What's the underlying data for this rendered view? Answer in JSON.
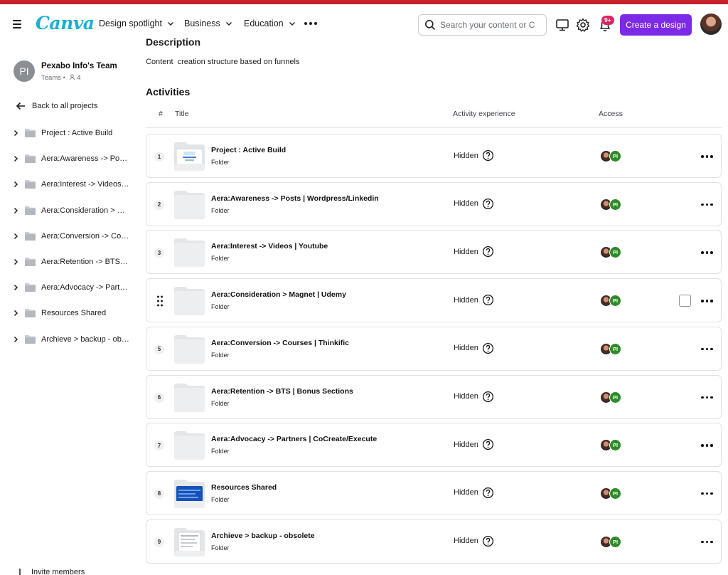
{
  "header": {
    "logo": "Canva",
    "nav": [
      {
        "label": "Design spotlight"
      },
      {
        "label": "Business"
      },
      {
        "label": "Education"
      }
    ],
    "search_placeholder": "Search your content or C",
    "notification_badge": "9+",
    "create_label": "Create a design"
  },
  "sidebar": {
    "team_initials": "PI",
    "team_name": "Pexabo Info's Team",
    "team_meta": "Teams •",
    "member_count": "4",
    "back_label": "Back to all projects",
    "folders": [
      {
        "label": "Project : Active Build"
      },
      {
        "label": "Aera:Awareness -> Posts | Wordpress/Linkedin"
      },
      {
        "label": "Aera:Interest -> Videos | Youtube"
      },
      {
        "label": "Aera:Consideration > Magnet | Udemy"
      },
      {
        "label": "Aera:Conversion -> Courses | Thinkific"
      },
      {
        "label": "Aera:Retention -> BTS | Bonus Sections"
      },
      {
        "label": "Aera:Advocacy -> Partners | CoCreate/Execute"
      },
      {
        "label": "Resources Shared"
      },
      {
        "label": "Archieve > backup - obsolete"
      }
    ],
    "invite_label": "Invite members"
  },
  "main": {
    "description_heading": "Description",
    "description_text": "Content  creation structure based on funnels",
    "activities_heading": "Activities",
    "columns": {
      "num": "#",
      "title": "Title",
      "experience": "Activity experience",
      "access": "Access"
    },
    "rows": [
      {
        "num": "1",
        "title": "Project : Active Build",
        "type": "Folder",
        "visibility": "Hidden",
        "thumb": "doc-preview",
        "access_initials": "PI"
      },
      {
        "num": "2",
        "title": "Aera:Awareness -> Posts | Wordpress/Linkedin",
        "type": "Folder",
        "visibility": "Hidden",
        "thumb": "empty",
        "access_initials": "PI"
      },
      {
        "num": "3",
        "title": "Aera:Interest -> Videos | Youtube",
        "type": "Folder",
        "visibility": "Hidden",
        "thumb": "empty",
        "access_initials": "PI"
      },
      {
        "num": "4",
        "title": "Aera:Consideration > Magnet | Udemy",
        "type": "Folder",
        "visibility": "Hidden",
        "thumb": "empty",
        "access_initials": "PI",
        "hovered": true
      },
      {
        "num": "5",
        "title": "Aera:Conversion -> Courses | Thinkific",
        "type": "Folder",
        "visibility": "Hidden",
        "thumb": "empty",
        "access_initials": "PI"
      },
      {
        "num": "6",
        "title": "Aera:Retention -> BTS | Bonus Sections",
        "type": "Folder",
        "visibility": "Hidden",
        "thumb": "empty",
        "access_initials": "PI"
      },
      {
        "num": "7",
        "title": "Aera:Advocacy -> Partners | CoCreate/Execute",
        "type": "Folder",
        "visibility": "Hidden",
        "thumb": "empty",
        "access_initials": "PI"
      },
      {
        "num": "8",
        "title": "Resources Shared",
        "type": "Folder",
        "visibility": "Hidden",
        "thumb": "blue-preview",
        "access_initials": "PI"
      },
      {
        "num": "9",
        "title": "Archieve > backup - obsolete",
        "type": "Folder",
        "visibility": "Hidden",
        "thumb": "list-preview",
        "access_initials": "PI"
      }
    ]
  },
  "colors": {
    "brand_purple": "#7d2ae8",
    "logo_teal": "#19b0d4",
    "badge_red": "#e0245e",
    "team_green": "#2f8a2a"
  }
}
